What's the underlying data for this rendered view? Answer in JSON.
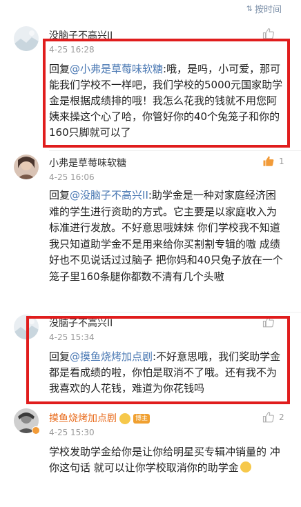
{
  "sort": {
    "label": "按时间",
    "icon": "sort-icon"
  },
  "comments": [
    {
      "user": "没脑子不高兴II",
      "time": "4-25 16:28",
      "likes": "",
      "reply_prefix": "回复",
      "mention": "@小弗是草莓味软糖",
      "text": ":哦，是吗，小可爱，那可能我们学校不一样吧，我们学校的5000元国家助学金是根据成绩排的哦！我怎么花我的钱就不用您阿姨来操这个心了哈，你管好你的40个兔笼子和你的160只脚就可以了"
    },
    {
      "user": "小弗是草莓味软糖",
      "time": "4-25 16:06",
      "likes": "1",
      "reply_prefix": "回复",
      "mention": "@没脑子不高兴II",
      "text": ":助学金是一种对家庭经济困难的学生进行资助的方式。它主要是以家庭收入为标准进行发放。不好意思哦妹妹 你们学校我不知道 我只知道助学金不是用来给你买割割专辑的嗷 成绩好也不见说话过过脑子 把你妈和40只兔子放在一个笼子里160条腿你都数不清有几个头嗷"
    },
    {
      "user": "没脑子不高兴II",
      "time": "4-25 15:34",
      "likes": "",
      "reply_prefix": "回复",
      "mention": "@摸鱼烧烤加点剧",
      "text": ":不好意思哦，我们奖助学金都是看成绩的啦，你怕是取消不了哦。还有我不为我喜欢的人花钱，难道为你花钱吗"
    },
    {
      "user": "摸鱼烧烤加点剧",
      "badge": "博主",
      "time": "4-25 15:30",
      "likes": "2",
      "text": "学校发助学金给你是让你给明星买专辑冲销量的  冲你这句话  就可以让你学校取消你的助学金"
    }
  ],
  "colors": {
    "highlight_border": "#e01d1d",
    "mention": "#4a78b3",
    "blogger_name": "#e86b1c"
  }
}
